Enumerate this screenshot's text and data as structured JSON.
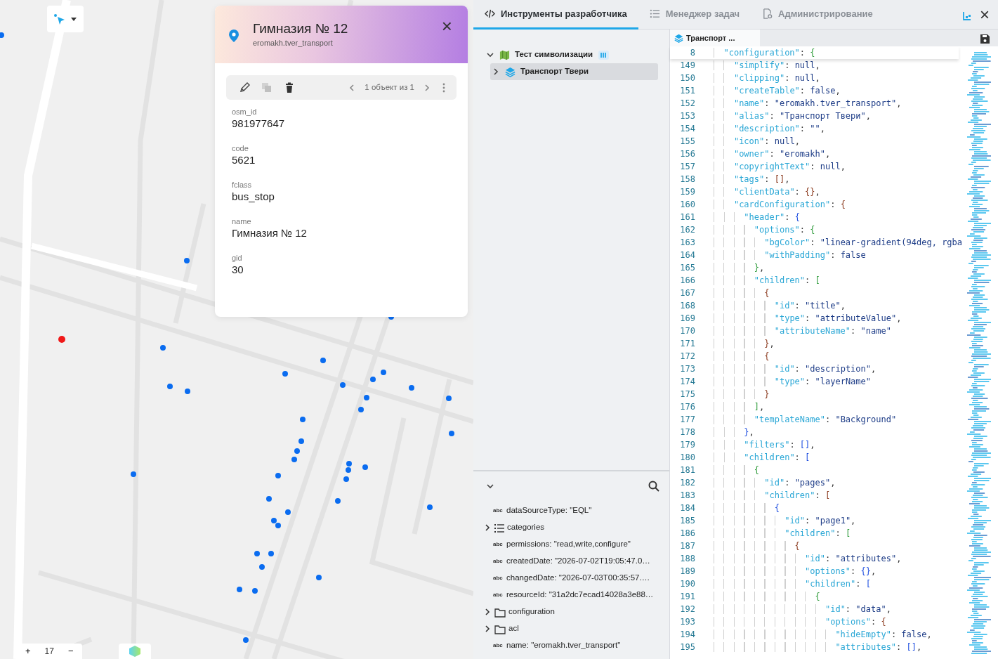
{
  "map": {
    "zoom_control": {
      "zoom_in": "+",
      "level": "17",
      "zoom_out": "−"
    }
  },
  "card": {
    "title": "Гимназия № 12",
    "subtitle": "eromakh.tver_transport",
    "close": "×",
    "pager": "1 объект из 1",
    "actions": [
      {
        "kind": "edit",
        "disabled": false
      },
      {
        "kind": "copy",
        "disabled": true
      },
      {
        "kind": "delete",
        "disabled": false
      }
    ],
    "fields": [
      {
        "label": "osm_id",
        "value": "981977647"
      },
      {
        "label": "code",
        "value": "5621"
      },
      {
        "label": "fclass",
        "value": "bus_stop"
      },
      {
        "label": "name",
        "value": "Гимназия № 12"
      },
      {
        "label": "gid",
        "value": "30"
      }
    ]
  },
  "devtools": {
    "tabs": [
      {
        "kind": "code",
        "label": "Инструменты разработчика",
        "selected": true
      },
      {
        "kind": "list",
        "label": "Менеджер задач",
        "selected": false
      },
      {
        "kind": "admin",
        "label": "Администрирование",
        "selected": false
      }
    ],
    "close": "×",
    "tree": [
      {
        "kind": "map",
        "label": "Тест символизации",
        "expanded": true,
        "selected": false,
        "children": [
          {
            "kind": "layer",
            "label": "Транспорт Твери",
            "expanded": false,
            "selected": true
          }
        ]
      }
    ],
    "properties": [
      {
        "kind": "value",
        "badge": "abc",
        "text": "dataSourceType: \"EQL\""
      },
      {
        "kind": "list",
        "text": "categories",
        "expanded": false
      },
      {
        "kind": "value",
        "badge": "abc",
        "text": "permissions: \"read,write,configure\""
      },
      {
        "kind": "value",
        "badge": "abc",
        "text": "createdDate: \"2026-07-02T19:05:47.0…"
      },
      {
        "kind": "value",
        "badge": "abc",
        "text": "changedDate: \"2026-07-03T00:35:57.…"
      },
      {
        "kind": "value",
        "badge": "abc",
        "text": "resourceId: \"31a2dc7ecad14028a3e88…"
      },
      {
        "kind": "folder",
        "text": "configuration",
        "expanded": false
      },
      {
        "kind": "folder",
        "text": "acl",
        "expanded": false
      },
      {
        "kind": "value",
        "badge": "abc",
        "text": "name: \"eromakh.tver_transport\""
      }
    ],
    "editor": {
      "tab": {
        "label": "Транспорт ...",
        "selected": true
      },
      "sticky": {
        "number": "8",
        "code": "  \"configuration\": {"
      },
      "lines": [
        {
          "number": "149",
          "code": "    \"simplify\": null,"
        },
        {
          "number": "150",
          "code": "    \"clipping\": null,"
        },
        {
          "number": "151",
          "code": "    \"createTable\": false,"
        },
        {
          "number": "152",
          "code": "    \"name\": \"eromakh.tver_transport\","
        },
        {
          "number": "153",
          "code": "    \"alias\": \"Транспорт Твери\","
        },
        {
          "number": "154",
          "code": "    \"description\": \"\","
        },
        {
          "number": "155",
          "code": "    \"icon\": null,"
        },
        {
          "number": "156",
          "code": "    \"owner\": \"eromakh\","
        },
        {
          "number": "157",
          "code": "    \"copyrightText\": null,"
        },
        {
          "number": "158",
          "code": "    \"tags\": [],"
        },
        {
          "number": "159",
          "code": "    \"clientData\": {},"
        },
        {
          "number": "160",
          "code": "    \"cardConfiguration\": {"
        },
        {
          "number": "161",
          "code": "      \"header\": {"
        },
        {
          "number": "162",
          "code": "        \"options\": {"
        },
        {
          "number": "163",
          "code": "          \"bgColor\": \"linear-gradient(94deg, rgba"
        },
        {
          "number": "164",
          "code": "          \"withPadding\": false"
        },
        {
          "number": "165",
          "code": "        },"
        },
        {
          "number": "166",
          "code": "        \"children\": ["
        },
        {
          "number": "167",
          "code": "          {"
        },
        {
          "number": "168",
          "code": "            \"id\": \"title\","
        },
        {
          "number": "169",
          "code": "            \"type\": \"attributeValue\","
        },
        {
          "number": "170",
          "code": "            \"attributeName\": \"name\""
        },
        {
          "number": "171",
          "code": "          },"
        },
        {
          "number": "172",
          "code": "          {"
        },
        {
          "number": "173",
          "code": "            \"id\": \"description\","
        },
        {
          "number": "174",
          "code": "            \"type\": \"layerName\""
        },
        {
          "number": "175",
          "code": "          }"
        },
        {
          "number": "176",
          "code": "        ],"
        },
        {
          "number": "177",
          "code": "        \"templateName\": \"Background\""
        },
        {
          "number": "178",
          "code": "      },"
        },
        {
          "number": "179",
          "code": "      \"filters\": [],"
        },
        {
          "number": "180",
          "code": "      \"children\": ["
        },
        {
          "number": "181",
          "code": "        {"
        },
        {
          "number": "182",
          "code": "          \"id\": \"pages\","
        },
        {
          "number": "183",
          "code": "          \"children\": ["
        },
        {
          "number": "184",
          "code": "            {"
        },
        {
          "number": "185",
          "code": "              \"id\": \"page1\","
        },
        {
          "number": "186",
          "code": "              \"children\": ["
        },
        {
          "number": "187",
          "code": "                {"
        },
        {
          "number": "188",
          "code": "                  \"id\": \"attributes\","
        },
        {
          "number": "189",
          "code": "                  \"options\": {},"
        },
        {
          "number": "190",
          "code": "                  \"children\": ["
        },
        {
          "number": "191",
          "code": "                    {"
        },
        {
          "number": "192",
          "code": "                      \"id\": \"data\","
        },
        {
          "number": "193",
          "code": "                      \"options\": {"
        },
        {
          "number": "194",
          "code": "                        \"hideEmpty\": false,"
        },
        {
          "number": "195",
          "code": "                        \"attributes\": [],"
        }
      ]
    }
  }
}
